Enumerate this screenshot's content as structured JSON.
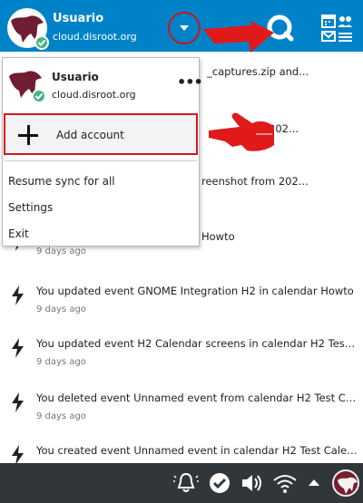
{
  "header": {
    "account_name": "Usuario",
    "account_server": "cloud.disroot.org",
    "dropdown_icon": "chevron-down-icon",
    "search_icon": "talk-search-icon",
    "apps_icon": "calendar-contacts-mail-icon",
    "brand_color": "#0082c9"
  },
  "background_items": [
    {
      "title": "",
      "title_visible": "_captures.zip and...",
      "time": ""
    },
    {
      "title_visible": "202...",
      "time": ""
    },
    {
      "title_visible": "reenshot from 202...",
      "time": ""
    },
    {
      "title_visible": "Howto",
      "time": "9 days ago"
    },
    {
      "title_visible": "You updated event GNOME Integration H2 in calendar Howto",
      "time": "9 days ago"
    },
    {
      "title_visible": "You updated event H2 Calendar screens in calendar H2 Test ...",
      "time": "9 days ago"
    },
    {
      "title_visible": "You deleted event Unnamed event from calendar H2 Test Cal...",
      "time": "9 days ago"
    },
    {
      "title_visible": "You created event Unnamed event in calendar H2 Test Calen...",
      "time": "9 days ago"
    }
  ],
  "menu": {
    "account_name": "Usuario",
    "account_server": "cloud.disroot.org",
    "more_label": "•••",
    "add_account": "Add account",
    "resume_sync": "Resume sync for all",
    "settings": "Settings",
    "exit": "Exit"
  },
  "taskbar": {
    "icons": [
      "notifications-icon",
      "nextcloud-sync-ok-icon",
      "volume-icon",
      "wifi-icon",
      "tray-expand-icon",
      "user-avatar-icon"
    ],
    "bg_color": "#31363b"
  },
  "annotations": {
    "highlight_color": "#d0191f"
  }
}
